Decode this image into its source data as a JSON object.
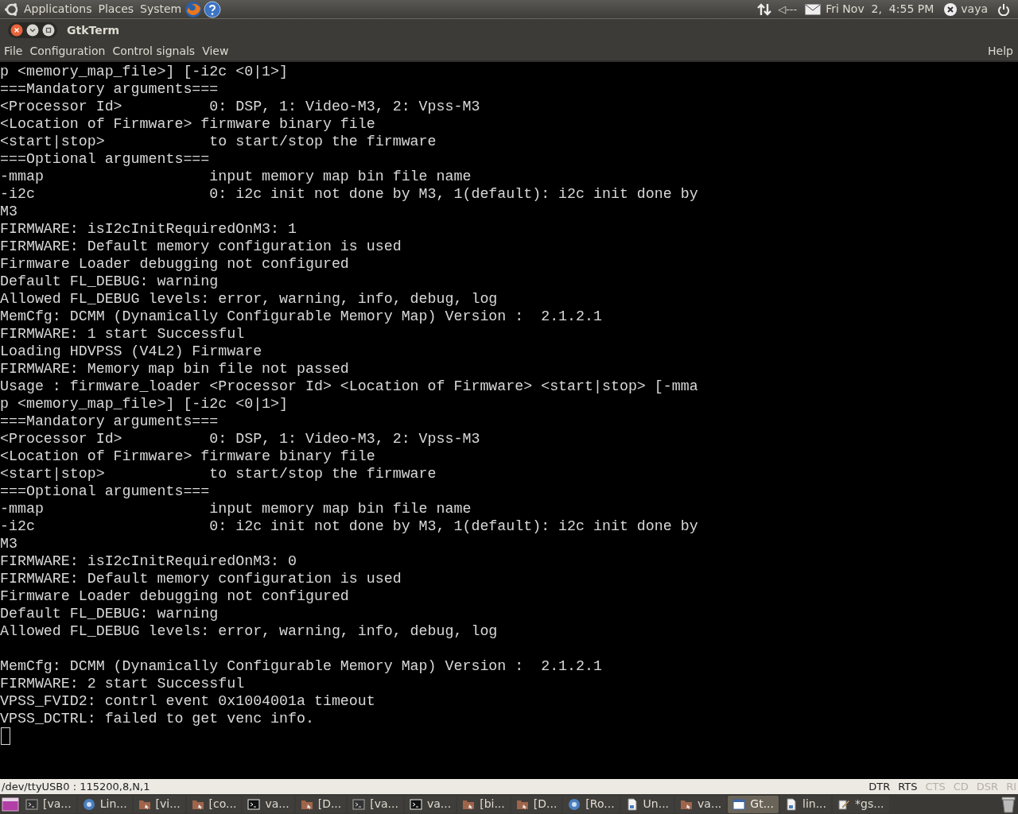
{
  "top_panel": {
    "menus": [
      "Applications",
      "Places",
      "System"
    ],
    "clock": "Fri Nov  2,  4:55 PM",
    "volume": "◁---",
    "user": "vaya"
  },
  "window": {
    "title": "GtkTerm"
  },
  "menu_bar": {
    "left": [
      "File",
      "Configuration",
      "Control signals",
      "View"
    ],
    "right": "Help"
  },
  "terminal": {
    "blocks": [
      {
        "lines": [
          "p <memory_map_file>] [-i2c <0|1>]",
          "===Mandatory arguments===",
          "<Processor Id>          0: DSP, 1: Video-M3, 2: Vpss-M3",
          "<Location of Firmware> firmware binary file",
          "<start|stop>            to start/stop the firmware",
          "===Optional arguments===",
          "-mmap                   input memory map bin file name",
          "-i2c                    0: i2c init not done by M3, 1(default): i2c init done by",
          "M3",
          "FIRMWARE: isI2cInitRequiredOnM3: 1",
          "FIRMWARE: Default memory configuration is used",
          "Firmware Loader debugging not configured",
          "Default FL_DEBUG: warning",
          "Allowed FL_DEBUG levels: error, warning, info, debug, log",
          "MemCfg: DCMM (Dynamically Configurable Memory Map) Version :  2.1.2.1",
          "FIRMWARE: 1 start Successful",
          "Loading HDVPSS (V4L2) Firmware",
          "FIRMWARE: Memory map bin file not passed",
          "Usage : firmware_loader <Processor Id> <Location of Firmware> <start|stop> [-mma",
          "p <memory_map_file>] [-i2c <0|1>]",
          "===Mandatory arguments===",
          "<Processor Id>          0: DSP, 1: Video-M3, 2: Vpss-M3",
          "<Location of Firmware> firmware binary file",
          "<start|stop>            to start/stop the firmware",
          "===Optional arguments===",
          "-mmap                   input memory map bin file name",
          "-i2c                    0: i2c init not done by M3, 1(default): i2c init done by",
          "M3",
          "FIRMWARE: isI2cInitRequiredOnM3: 0",
          "FIRMWARE: Default memory configuration is used",
          "Firmware Loader debugging not configured",
          "Default FL_DEBUG: warning",
          "Allowed FL_DEBUG levels: error, warning, info, debug, log"
        ]
      },
      {
        "lines": [
          "MemCfg: DCMM (Dynamically Configurable Memory Map) Version :  2.1.2.1",
          "FIRMWARE: 2 start Successful",
          "VPSS_FVID2: contrl event 0x1004001a timeout",
          "VPSS_DCTRL: failed to get venc info."
        ]
      }
    ]
  },
  "status_bar": {
    "port": "/dev/ttyUSB0 : 115200,8,N,1",
    "signals": [
      {
        "label": "DTR",
        "on": true
      },
      {
        "label": "RTS",
        "on": true
      },
      {
        "label": "CTS",
        "on": false
      },
      {
        "label": "CD",
        "on": false
      },
      {
        "label": "DSR",
        "on": false
      },
      {
        "label": "RI",
        "on": false
      }
    ]
  },
  "taskbar": {
    "items": [
      {
        "kind": "terminal",
        "label": "[va...",
        "selected": false
      },
      {
        "kind": "browser",
        "label": "Lin...",
        "selected": false
      },
      {
        "kind": "folder",
        "label": "[vi...",
        "selected": false
      },
      {
        "kind": "folder",
        "label": "[co...",
        "selected": false
      },
      {
        "kind": "terminal-dark",
        "label": "va...",
        "selected": false
      },
      {
        "kind": "folder",
        "label": "[D...",
        "selected": false
      },
      {
        "kind": "terminal",
        "label": "[va...",
        "selected": false
      },
      {
        "kind": "terminal-dark",
        "label": "va...",
        "selected": false
      },
      {
        "kind": "folder",
        "label": "[bi...",
        "selected": false
      },
      {
        "kind": "folder",
        "label": "[D...",
        "selected": false
      },
      {
        "kind": "browser",
        "label": "[Ro...",
        "selected": false
      },
      {
        "kind": "document",
        "label": "Un...",
        "selected": false
      },
      {
        "kind": "folder",
        "label": "va...",
        "selected": false
      },
      {
        "kind": "window",
        "label": "Gt...",
        "selected": true
      },
      {
        "kind": "document",
        "label": "lin...",
        "selected": false
      },
      {
        "kind": "editor",
        "label": "*gs...",
        "selected": false
      }
    ]
  }
}
